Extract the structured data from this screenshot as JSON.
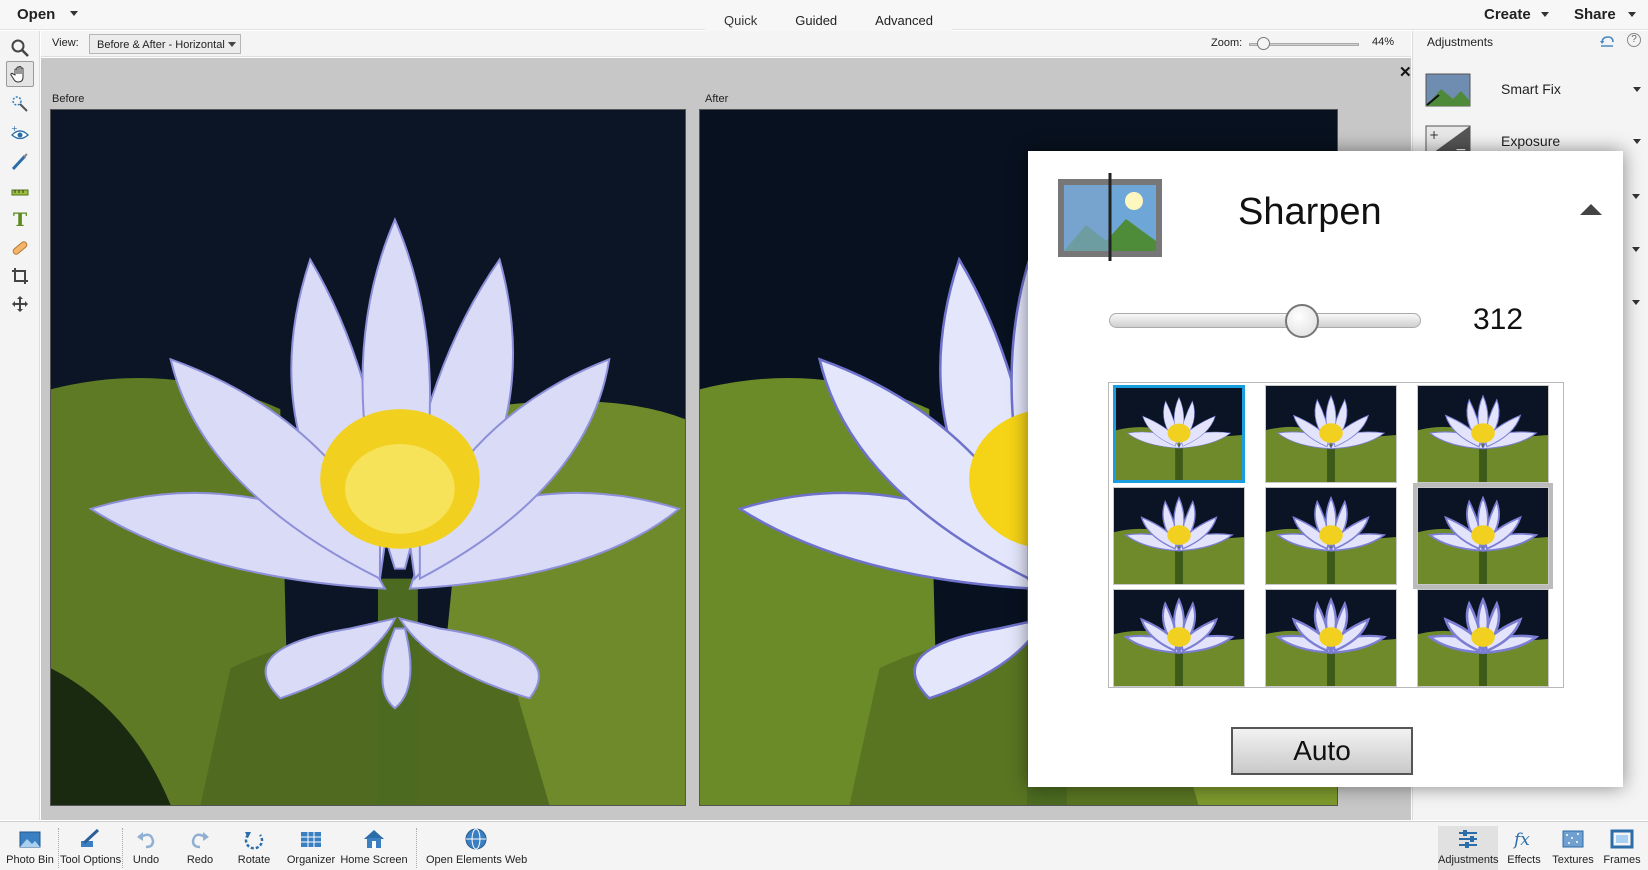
{
  "topbar": {
    "open_label": "Open",
    "tabs": [
      "Quick",
      "Guided",
      "Advanced"
    ],
    "active_tab": "Quick",
    "create_label": "Create",
    "share_label": "Share"
  },
  "options": {
    "view_label": "View:",
    "view_value": "Before & After - Horizontal",
    "zoom_label": "Zoom:",
    "zoom_value": "44%",
    "zoom_level": 0.13
  },
  "canvas": {
    "before_label": "Before",
    "after_label": "After",
    "close_glyph": "✕"
  },
  "toolbox": {
    "tools": [
      "zoom-tool-icon",
      "hand-tool-icon",
      "quick-selection-icon",
      "red-eye-icon",
      "whiten-teeth-icon",
      "straighten-icon",
      "type-tool-icon",
      "spot-healing-icon",
      "crop-tool-icon",
      "move-tool-icon"
    ],
    "selected": "hand-tool-icon"
  },
  "adjustments": {
    "title": "Adjustments",
    "help_glyph": "?",
    "items": [
      {
        "label": "Smart Fix"
      },
      {
        "label": "Exposure"
      }
    ]
  },
  "sharpen": {
    "title": "Sharpen",
    "value": "312",
    "slider_fraction": 0.62,
    "selected_preset_index": 0,
    "auto_label": "Auto"
  },
  "bottombar": {
    "items": [
      {
        "label": "Photo Bin",
        "icon": "photo-bin-icon"
      },
      {
        "label": "Tool Options",
        "icon": "tool-options-icon"
      },
      {
        "label": "Undo",
        "icon": "undo-icon"
      },
      {
        "label": "Redo",
        "icon": "redo-icon"
      },
      {
        "label": "Rotate",
        "icon": "rotate-icon"
      },
      {
        "label": "Organizer",
        "icon": "organizer-icon"
      },
      {
        "label": "Home Screen",
        "icon": "home-icon"
      },
      {
        "label": "Open Elements Web",
        "icon": "globe-icon"
      },
      {
        "label": "Adjustments",
        "icon": "adjustments-icon"
      },
      {
        "label": "Effects",
        "icon": "fx-icon"
      },
      {
        "label": "Textures",
        "icon": "textures-icon"
      },
      {
        "label": "Frames",
        "icon": "frames-icon"
      }
    ]
  },
  "colors": {
    "accent_selected": "#1a9ee0",
    "photo_background": "#0a1424",
    "lily_pad": "#6f8a2a",
    "petal": "#b6b8ee",
    "stamen": "#f2d020"
  }
}
